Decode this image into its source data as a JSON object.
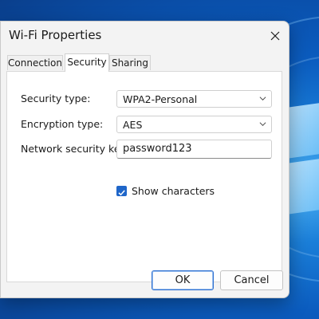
{
  "window": {
    "title": "Wi-Fi Properties",
    "close_icon": "close-icon"
  },
  "tabs": [
    {
      "label": "Connection",
      "active": false
    },
    {
      "label": "Security",
      "active": true
    },
    {
      "label": "Sharing",
      "active": false
    }
  ],
  "security": {
    "security_type_label": "Security type:",
    "security_type_value": "WPA2-Personal",
    "encryption_type_label": "Encryption type:",
    "encryption_type_value": "AES",
    "key_label": "Network security key:",
    "key_value": "password123",
    "show_characters_label": "Show characters",
    "show_characters_checked": true
  },
  "buttons": {
    "ok_label": "OK",
    "cancel_label": "Cancel"
  },
  "colors": {
    "accent": "#1f66c9",
    "dialog_bg": "#f3f3f3",
    "desktop_bg": "#0b5cbf"
  }
}
